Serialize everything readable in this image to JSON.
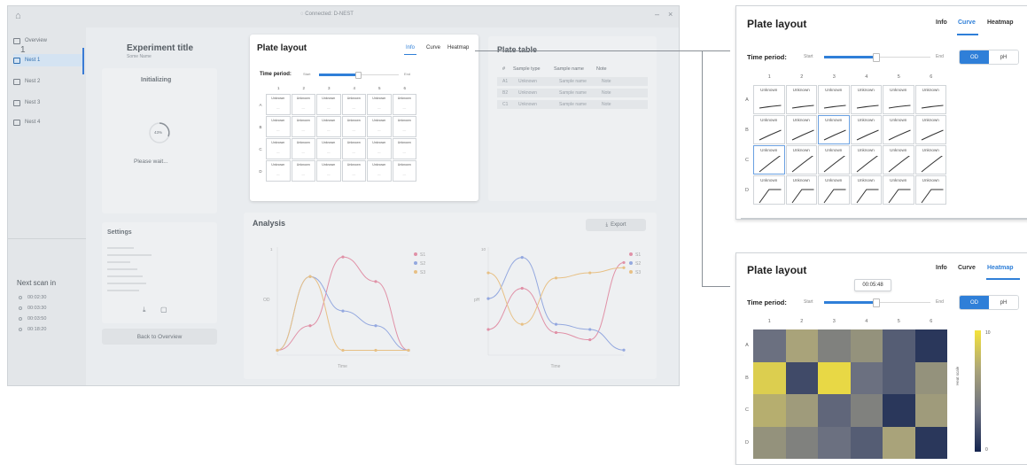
{
  "window": {
    "title": "◌ Connected: D-NEST"
  },
  "sidebar": {
    "items": [
      {
        "label": "Overview"
      },
      {
        "label": "Nest 1"
      },
      {
        "label": "Nest 2"
      },
      {
        "label": "Nest 3"
      },
      {
        "label": "Nest 4"
      }
    ],
    "next_scan_title": "Next scan in",
    "next_scans": [
      "00:02:30",
      "00:03:30",
      "00:03:50",
      "00:18:20"
    ]
  },
  "experiment": {
    "number": "1",
    "title": "Experiment title",
    "subtitle": "Some Name",
    "status": "Initializing",
    "progress_label": "43%",
    "wait_text": "Please wait...",
    "settings_title": "Settings",
    "back_button": "Back to Overview"
  },
  "plate_main": {
    "title": "Plate layout",
    "tabs": [
      "Info",
      "Curve",
      "Heatmap"
    ],
    "active_tab": "Info",
    "time_period_label": "Time period:",
    "slider_start": "Start",
    "slider_end": "End",
    "slider_value": 0.48,
    "columns": [
      "1",
      "2",
      "3",
      "4",
      "5",
      "6"
    ],
    "rows": [
      "A",
      "B",
      "C",
      "D"
    ],
    "cell_label": "Unknown",
    "cell_sub": "—"
  },
  "plate_table": {
    "title": "Plate table",
    "headers": [
      "#",
      "Sample type",
      "Sample name",
      "Note"
    ],
    "rows": [
      [
        "A1",
        "Unknown",
        "Sample name",
        "Note"
      ],
      [
        "B2",
        "Unknown",
        "Sample name",
        "Note"
      ],
      [
        "C1",
        "Unknown",
        "Sample name",
        "Note"
      ]
    ]
  },
  "analysis": {
    "title": "Analysis",
    "export_label": "Export",
    "chart1": {
      "ylabel": "OD",
      "xlabel": "Time",
      "ytop": "1"
    },
    "chart2": {
      "ylabel": "pH",
      "xlabel": "Time",
      "ytop": "10"
    }
  },
  "chart_data": [
    {
      "type": "line",
      "title": "",
      "xlabel": "Time",
      "ylabel": "OD",
      "x": [
        0,
        1,
        2,
        3,
        4
      ],
      "series": [
        {
          "name": "S1",
          "color": "#d6456a",
          "values": [
            0.05,
            0.3,
            1.0,
            0.75,
            0.05
          ]
        },
        {
          "name": "S2",
          "color": "#4b6fd0",
          "values": [
            0.05,
            0.8,
            0.45,
            0.3,
            0.05
          ]
        },
        {
          "name": "S3",
          "color": "#e39a2d",
          "values": [
            0.05,
            0.8,
            0.05,
            0.05,
            0.05
          ]
        }
      ],
      "legend": "top-right"
    },
    {
      "type": "line",
      "title": "",
      "xlabel": "Time",
      "ylabel": "pH",
      "x": [
        0,
        1,
        2,
        3,
        4
      ],
      "series": [
        {
          "name": "S1",
          "color": "#d6456a",
          "values": [
            2.5,
            6.5,
            2.2,
            1.5,
            9.0
          ]
        },
        {
          "name": "S2",
          "color": "#4b6fd0",
          "values": [
            5.5,
            9.5,
            3.0,
            2.5,
            0.5
          ]
        },
        {
          "name": "S3",
          "color": "#e39a2d",
          "values": [
            8.0,
            3.0,
            7.5,
            8.0,
            8.5
          ]
        }
      ],
      "legend": "top-right"
    }
  ],
  "zoom_curve": {
    "title": "Plate layout",
    "tabs": [
      "Info",
      "Curve",
      "Heatmap"
    ],
    "active_tab": "Curve",
    "time_period_label": "Time period:",
    "slider_start": "Start",
    "slider_end": "End",
    "slider_value": 0.48,
    "toggle": [
      "OD",
      "pH"
    ],
    "toggle_active": "OD",
    "columns": [
      "1",
      "2",
      "3",
      "4",
      "5",
      "6"
    ],
    "rows": [
      "A",
      "B",
      "C",
      "D"
    ],
    "cell_label": "Unknown"
  },
  "zoom_heatmap": {
    "title": "Plate layout",
    "tabs": [
      "Info",
      "Curve",
      "Heatmap"
    ],
    "active_tab": "Heatmap",
    "time_period_label": "Time period:",
    "slider_start": "Start",
    "slider_end": "End",
    "slider_value": 0.48,
    "tooltip": "00:05:48",
    "toggle": [
      "OD",
      "pH"
    ],
    "toggle_active": "OD",
    "columns": [
      "1",
      "2",
      "3",
      "4",
      "5",
      "6"
    ],
    "rows": [
      "A",
      "B",
      "C",
      "D"
    ],
    "colorbar_max": "10",
    "colorbar_min": "0",
    "colorbar_label": "Heat scale",
    "values": [
      [
        4,
        7,
        5,
        6,
        3,
        1
      ],
      [
        9,
        2,
        9.5,
        4,
        3,
        6
      ],
      [
        7.5,
        6.5,
        3.5,
        5,
        1,
        6.5
      ],
      [
        6,
        5,
        4,
        3,
        7,
        1
      ]
    ]
  }
}
